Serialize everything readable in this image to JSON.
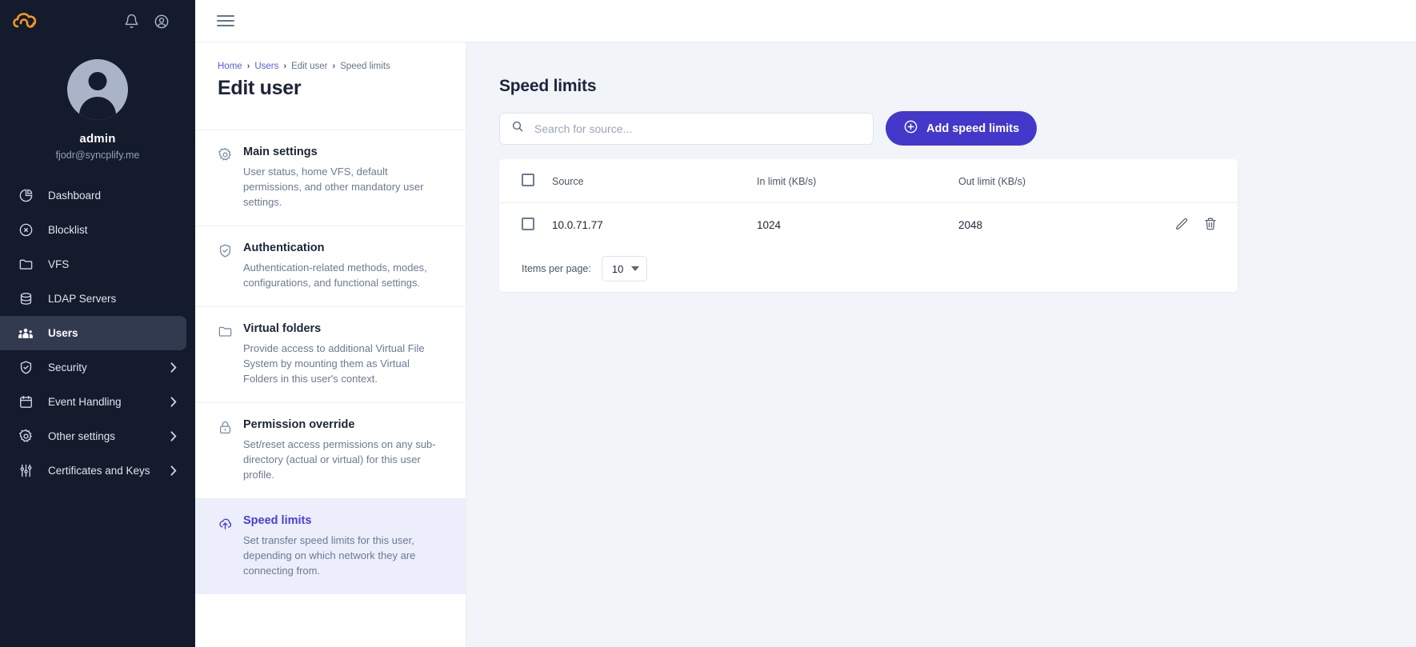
{
  "sidebar": {
    "logo_icon": "syncplify-cloud-logo",
    "top_icons": [
      {
        "name": "notifications-bell-icon"
      },
      {
        "name": "account-circle-icon"
      }
    ],
    "profile": {
      "avatar_icon": "user-avatar",
      "name": "admin",
      "email": "fjodr@syncplify.me"
    },
    "items": [
      {
        "label": "Dashboard",
        "icon": "pie-chart-icon",
        "active": false,
        "chevron": false
      },
      {
        "label": "Blocklist",
        "icon": "block-circle-icon",
        "active": false,
        "chevron": false
      },
      {
        "label": "VFS",
        "icon": "folder-icon",
        "active": false,
        "chevron": false
      },
      {
        "label": "LDAP Servers",
        "icon": "database-icon",
        "active": false,
        "chevron": false
      },
      {
        "label": "Users",
        "icon": "users-group-icon",
        "active": true,
        "chevron": false
      },
      {
        "label": "Security",
        "icon": "shield-check-icon",
        "active": false,
        "chevron": true
      },
      {
        "label": "Event Handling",
        "icon": "calendar-icon",
        "active": false,
        "chevron": true
      },
      {
        "label": "Other settings",
        "icon": "gear-icon",
        "active": false,
        "chevron": true
      },
      {
        "label": "Certificates and Keys",
        "icon": "sliders-icon",
        "active": false,
        "chevron": true
      }
    ]
  },
  "topbar": {
    "menu_icon": "hamburger-menu-icon"
  },
  "breadcrumb": [
    {
      "label": "Home",
      "link": true
    },
    {
      "label": "Users",
      "link": true
    },
    {
      "label": "Edit user",
      "link": false
    },
    {
      "label": "Speed limits",
      "link": false
    }
  ],
  "breadcrumb_separator": "›",
  "page": {
    "title": "Edit user"
  },
  "settings_cards": [
    {
      "title": "Main settings",
      "icon": "gear-icon",
      "desc": "User status, home VFS, default permissions, and other mandatory user settings.",
      "selected": false
    },
    {
      "title": "Authentication",
      "icon": "shield-check-icon",
      "desc": "Authentication-related methods, modes, configurations, and functional settings.",
      "selected": false
    },
    {
      "title": "Virtual folders",
      "icon": "folder-icon",
      "desc": "Provide access to additional Virtual File System by mounting them as Virtual Folders in this user's context.",
      "selected": false
    },
    {
      "title": "Permission override",
      "icon": "lock-icon",
      "desc": "Set/reset access permissions on any sub-directory (actual or virtual) for this user profile.",
      "selected": false
    },
    {
      "title": "Speed limits",
      "icon": "cloud-upload-icon",
      "desc": "Set transfer speed limits for this user, depending on which network they are connecting from.",
      "selected": true
    }
  ],
  "content": {
    "title": "Speed limits",
    "search": {
      "placeholder": "Search for source...",
      "value": "",
      "icon": "search-icon"
    },
    "add_button": {
      "label": "Add speed limits",
      "icon": "plus-circle-icon"
    },
    "table": {
      "columns": [
        "Source",
        "In limit (KB/s)",
        "Out limit (KB/s)"
      ],
      "rows": [
        {
          "source": "10.0.71.77",
          "in_limit": "1024",
          "out_limit": "2048",
          "checked": false,
          "actions": [
            "edit-pencil-icon",
            "delete-trash-icon"
          ]
        }
      ],
      "select_all_checked": false
    },
    "footer": {
      "items_per_page_label": "Items per page:",
      "items_per_page_value": "10"
    }
  },
  "colors": {
    "accent": "#4338ca",
    "sidebar_bg": "#141b2d",
    "selected_card_bg": "#eceefc",
    "content_bg": "#f1f4f9",
    "logo_orange": "#f59a23"
  }
}
